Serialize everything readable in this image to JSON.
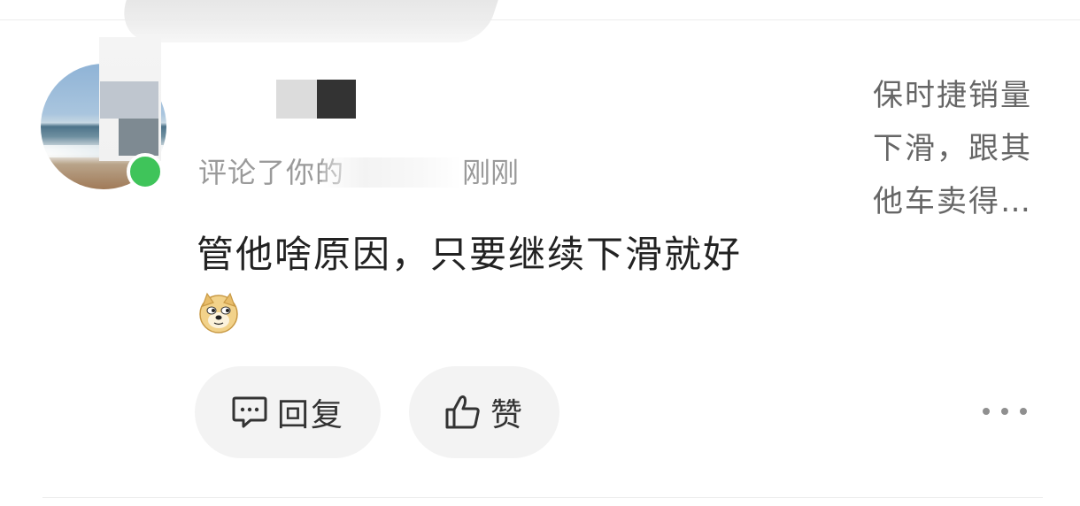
{
  "notification": {
    "meta_prefix": "评论了你的",
    "meta_time": "刚刚",
    "comment_text": "管他啥原因，只要继续下滑就好",
    "emoji_icon": "doge-emoji-icon",
    "article_snippet": [
      "保时捷销量",
      "下滑，跟其",
      "他车卖得…"
    ]
  },
  "actions": {
    "reply_label": "回复",
    "like_label": "赞",
    "reply_icon": "comment-bubble-icon",
    "like_icon": "thumbs-up-icon",
    "more_icon": "more-dots-icon"
  },
  "colors": {
    "online_dot": "#3fc45a",
    "pill_bg": "#f3f3f3",
    "text_primary": "#222222",
    "text_secondary": "#9a9a9a"
  }
}
